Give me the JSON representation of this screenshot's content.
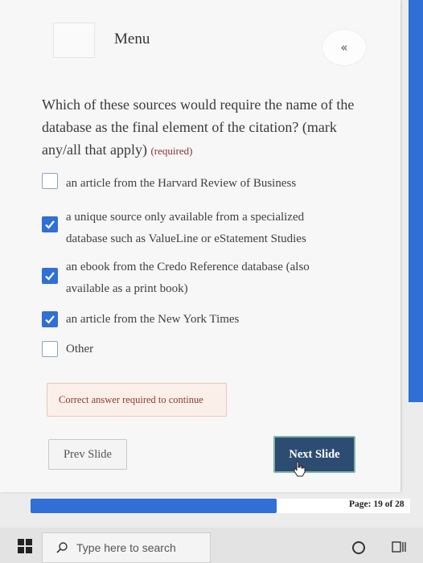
{
  "header": {
    "title": "Menu",
    "collapse_label": "«"
  },
  "question": {
    "text": "Which of these sources would require the name of the database as the final element of the citation? (mark any/all that apply)",
    "required_label": "(required)"
  },
  "options": [
    {
      "line1": "an article from the Harvard Review of Business",
      "line2": "",
      "checked": false
    },
    {
      "line1": "a unique source only available from a specialized",
      "line2": "database such as ValueLine or eStatement Studies",
      "checked": true
    },
    {
      "line1": "an ebook from the Credo Reference database (also",
      "line2": "available as a print book)",
      "checked": true
    },
    {
      "line1": "an article from the New York Times",
      "line2": "",
      "checked": true
    },
    {
      "line1": "Other",
      "line2": "",
      "checked": false
    }
  ],
  "feedback": "Correct answer required to continue",
  "buttons": {
    "prev": "Prev Slide",
    "next": "Next Slide"
  },
  "progress": {
    "label": "Page: 19 of 28",
    "current": 19,
    "total": 28
  },
  "taskbar": {
    "search_placeholder": "Type here to search"
  },
  "colors": {
    "accent": "#2f6fd6",
    "next_button": "#2d4c72",
    "feedback_bg": "#fbefea",
    "feedback_text": "#8b3b2f"
  }
}
